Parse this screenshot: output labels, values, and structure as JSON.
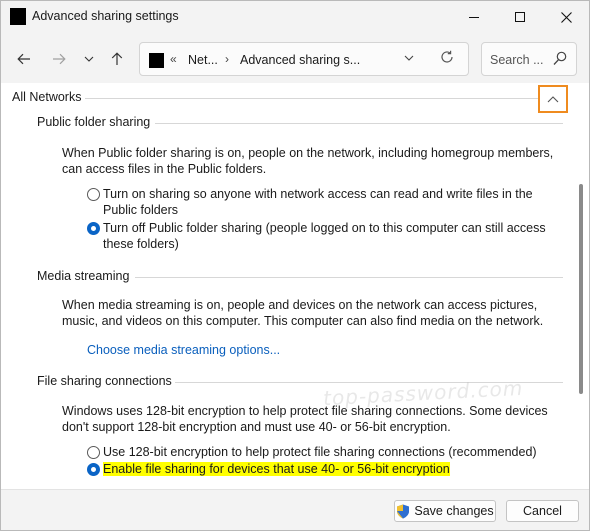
{
  "window": {
    "title": "Advanced sharing settings"
  },
  "nav": {
    "crumbs": [
      "Net...",
      "Advanced sharing s..."
    ],
    "search_placeholder": "Search ..."
  },
  "content": {
    "group_title": "All Networks",
    "sections": {
      "public": {
        "title": "Public folder sharing",
        "description": "When Public folder sharing is on, people on the network, including homegroup members, can access files in the Public folders.",
        "option_on": "Turn on sharing so anyone with network access can read and write files in the Public folders",
        "option_off": "Turn off Public folder sharing (people logged on to this computer can still access these folders)",
        "selected": "option_off"
      },
      "media": {
        "title": "Media streaming",
        "description": "When media streaming is on, people and devices on the network can access pictures, music, and videos on this computer. This computer can also find media on the network.",
        "link": "Choose media streaming options..."
      },
      "filesharing": {
        "title": "File sharing connections",
        "description": "Windows uses 128-bit encryption to help protect file sharing connections. Some devices don't support 128-bit encryption and must use 40- or 56-bit encryption.",
        "option_128": "Use 128-bit encryption to help protect file sharing connections (recommended)",
        "option_40_56": "Enable file sharing for devices that use 40- or 56-bit encryption",
        "selected": "option_40_56"
      }
    },
    "watermark": "top-password.com"
  },
  "footer": {
    "save_label": "Save changes",
    "cancel_label": "Cancel"
  },
  "colors": {
    "accent": "#0a64c6",
    "link": "#0a5fbd",
    "highlight": "#ffff00",
    "callout": "#ef8b1f"
  }
}
